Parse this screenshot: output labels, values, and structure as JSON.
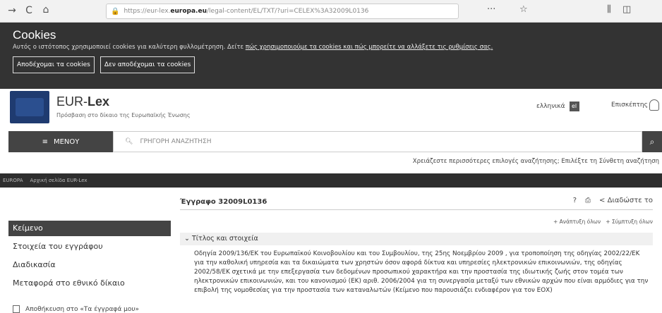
{
  "browser": {
    "url_prefix": "https://eur-lex.",
    "url_domain": "europa.eu",
    "url_suffix": "/legal-content/EL/TXT/?uri=CELEX%3A32009L0136",
    "back": "←",
    "forward": "→",
    "reload": "C",
    "home": "⌂",
    "more": "···",
    "bookmark": "☆",
    "library": "⫼",
    "sidebar": "◫"
  },
  "cookie_banner": {
    "title": "Cookies",
    "text": "Αυτός ο ιστότοπος χρησιμοποιεί cookies για καλύτερη φυλλομέτρηση. Δείτε ",
    "link_text": "πώς χρησιμοποιούμε τα cookies και πώς μπορείτε να αλλάξετε τις ρυθμίσεις σας.",
    "accept_label": "Αποδέχομαι τα cookies",
    "reject_label": "Δεν αποδέχομαι τα cookies"
  },
  "site": {
    "title_regular": "EUR-",
    "title_bold": "Lex",
    "subtitle": "Πρόσβαση στο δίκαιο της Ευρωπαϊκής Ένωσης",
    "language": "ελληνικά",
    "language_code": "el",
    "visitor": "Επισκέπτης"
  },
  "nav": {
    "menu_label": "ΜΕΝΟΥ",
    "search_placeholder": "ΓΡΗΓΟΡΗ ΑΝΑΖΗΤΗΣΗ",
    "advanced_text": "Χρειάζεστε περισσότερες επιλογές αναζήτησης; Επιλέξτε τη Σύνθετη αναζήτηση"
  },
  "breadcrumb": {
    "root": "EUROPA",
    "second": "Αρχική σελίδα EUR-Lex"
  },
  "sidebar": {
    "items": [
      {
        "label": "Κείμενο"
      },
      {
        "label": "Στοιχεία του εγγράφου"
      },
      {
        "label": "Διαδικασία"
      },
      {
        "label": "Μεταφορά στο εθνικό δίκαιο"
      }
    ],
    "save_label": "Αποθήκευση στο «Τα έγγραφά μου»"
  },
  "document": {
    "id_label": "Έγγραφο 32009L0136",
    "share_label": "Διαδώστε το",
    "expand_all": "+ Ανάπτυξη όλων",
    "collapse_all": "+ Σύμπτυξη όλων",
    "section_title": "Τίτλος και στοιχεία",
    "section_text": "Οδηγία 2009/136/ΕΚ του Ευρωπαϊκού Κοινοβουλίου και του Συμβουλίου, της 25ης Νοεμβρίου 2009 , για τροποποίηση της οδηγίας 2002/22/ΕΚ για την καθολική υπηρεσία και τα δικαιώματα των χρηστών όσον αφορά δίκτυα και υπηρεσίες ηλεκτρονικών επικοινωνιών, της οδηγίας 2002/58/ΕΚ σχετικά με την επεξεργασία των δεδομένων προσωπικού χαρακτήρα και την προστασία της ιδιωτικής ζωής στον τομέα των ηλεκτρονικών επικοινωνιών, και του κανονισμού (ΕΚ) αριθ. 2006/2004 για τη συνεργασία μεταξύ των εθνικών αρχών που είναι αρμόδιες για την επιβολή της νομοθεσίας για την προστασία των καταναλωτών (Κείμενο που παρουσιάζει ενδιαφέρον για τον ΕΟΧ)"
  }
}
